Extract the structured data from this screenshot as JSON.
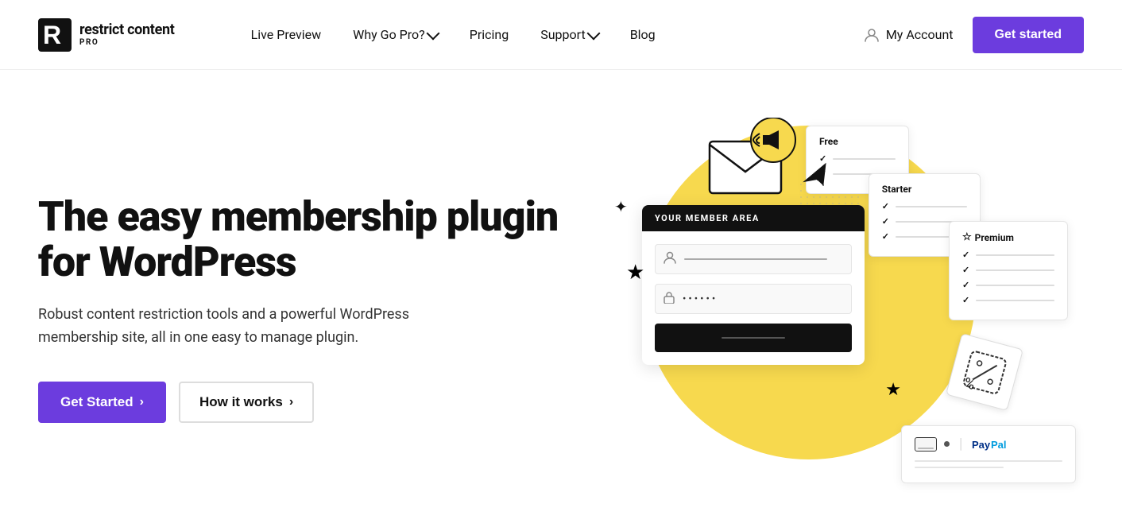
{
  "brand": {
    "logo_text": "restrict content",
    "logo_pro": "PRO",
    "logo_aria": "Restrict Content Pro"
  },
  "nav": {
    "live_preview": "Live Preview",
    "why_go_pro": "Why Go Pro?",
    "pricing": "Pricing",
    "support": "Support",
    "blog": "Blog",
    "my_account": "My Account",
    "get_started": "Get started"
  },
  "hero": {
    "title": "The easy membership plugin for WordPress",
    "subtitle": "Robust content restriction tools and a powerful WordPress membership site, all in one easy to manage plugin.",
    "cta_primary": "Get Started",
    "cta_secondary": "How it works"
  },
  "illustration": {
    "member_area_label": "YOUR MEMBER AREA",
    "password_dots": "••••••",
    "pricing_free": "Free",
    "pricing_starter": "Starter",
    "pricing_premium": "Premium"
  }
}
